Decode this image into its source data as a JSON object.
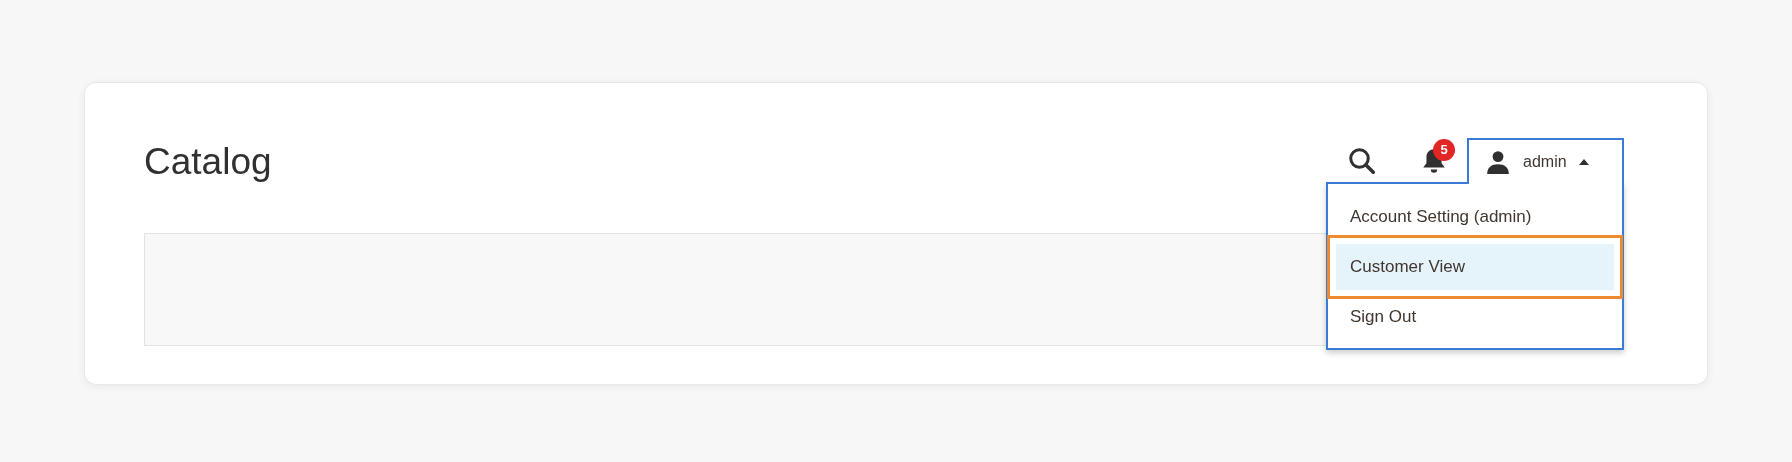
{
  "page_title": "Catalog",
  "header": {
    "notifications_count": "5",
    "user": {
      "name": "admin",
      "expanded": true
    }
  },
  "user_menu": [
    {
      "label": "Account Setting (admin)",
      "selected": false
    },
    {
      "label": "Customer View",
      "selected": true
    },
    {
      "label": "Sign Out",
      "selected": false
    }
  ]
}
